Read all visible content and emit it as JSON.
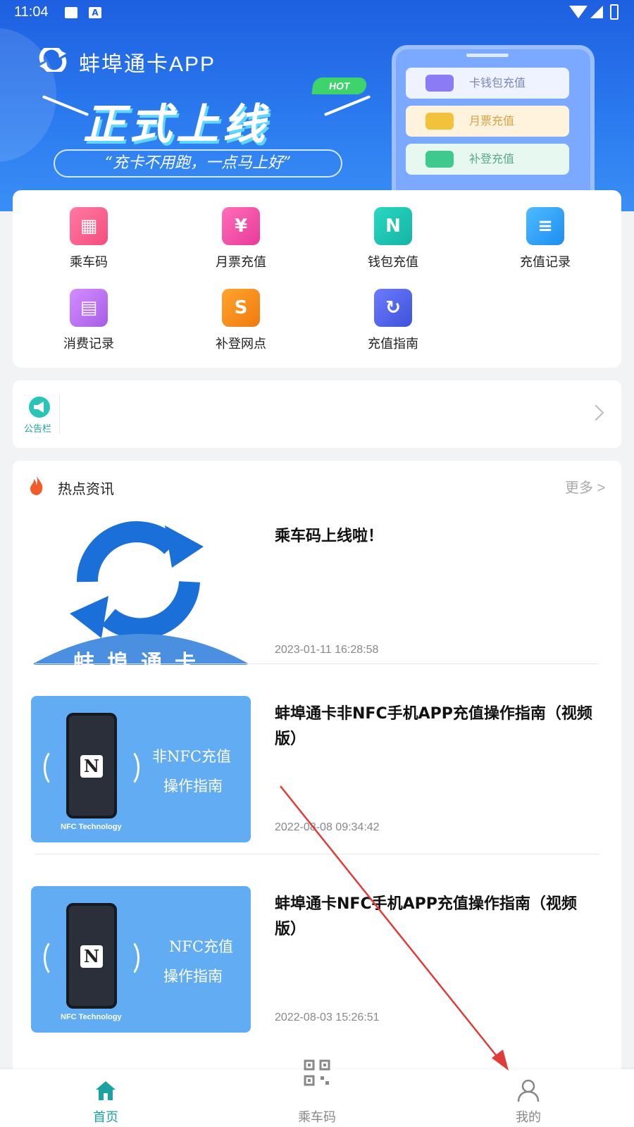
{
  "status_bar": {
    "time": "11:04",
    "a_icon": "A"
  },
  "banner": {
    "app_title": "蚌埠通卡APP",
    "hot": "HOT",
    "headline": "正式上线",
    "slogan": "“充卡不用跑，一点马上好”",
    "pills": [
      {
        "label": "卡钱包充值",
        "icon": "wallet-icon"
      },
      {
        "label": "月票充值",
        "icon": "calendar-icon"
      },
      {
        "label": "补登充值",
        "icon": "check-icon"
      }
    ]
  },
  "menu": {
    "items": [
      {
        "label": "乘车码",
        "icon": "qr-bus-icon",
        "color": "#f54d7d"
      },
      {
        "label": "月票充值",
        "icon": "ticket-icon",
        "color": "#e8399a"
      },
      {
        "label": "钱包充值",
        "icon": "nfc-icon",
        "color": "#15b4a6"
      },
      {
        "label": "充值记录",
        "icon": "document-icon",
        "color": "#1e8df0"
      },
      {
        "label": "消费记录",
        "icon": "receipt-icon",
        "color": "#a65de8"
      },
      {
        "label": "补登网点",
        "icon": "route-icon",
        "color": "#f07a0e"
      },
      {
        "label": "充值指南",
        "icon": "refresh-icon",
        "color": "#3e52d8"
      }
    ]
  },
  "notice": {
    "label": "公告栏"
  },
  "news": {
    "title": "热点资讯",
    "more": "更多 >",
    "items": [
      {
        "title": "乘车码上线啦！",
        "date": "2023-01-11 16:28:58",
        "thumb_text": "蚌埠通卡"
      },
      {
        "title": "蚌埠通卡非NFC手机APP充值操作指南（视频版）",
        "date": "2022-08-08 09:34:42",
        "thumb_line1": "非NFC充值",
        "thumb_line2": "操作指南",
        "thumb_caption": "NFC Technology"
      },
      {
        "title": "蚌埠通卡NFC手机APP充值操作指南（视频版）",
        "date": "2022-08-03 15:26:51",
        "thumb_line1": "NFC充值",
        "thumb_line2": "操作指南",
        "thumb_caption": "NFC Technology"
      }
    ]
  },
  "tabs": [
    {
      "label": "首页",
      "icon": "home-icon",
      "active": true
    },
    {
      "label": "乘车码",
      "icon": "qr-code-icon",
      "active": false
    },
    {
      "label": "我的",
      "icon": "person-icon",
      "active": false
    }
  ],
  "colors": {
    "accent": "#1aa3a0",
    "banner": "#1d5fe0",
    "annotation": "#e03c3c"
  }
}
